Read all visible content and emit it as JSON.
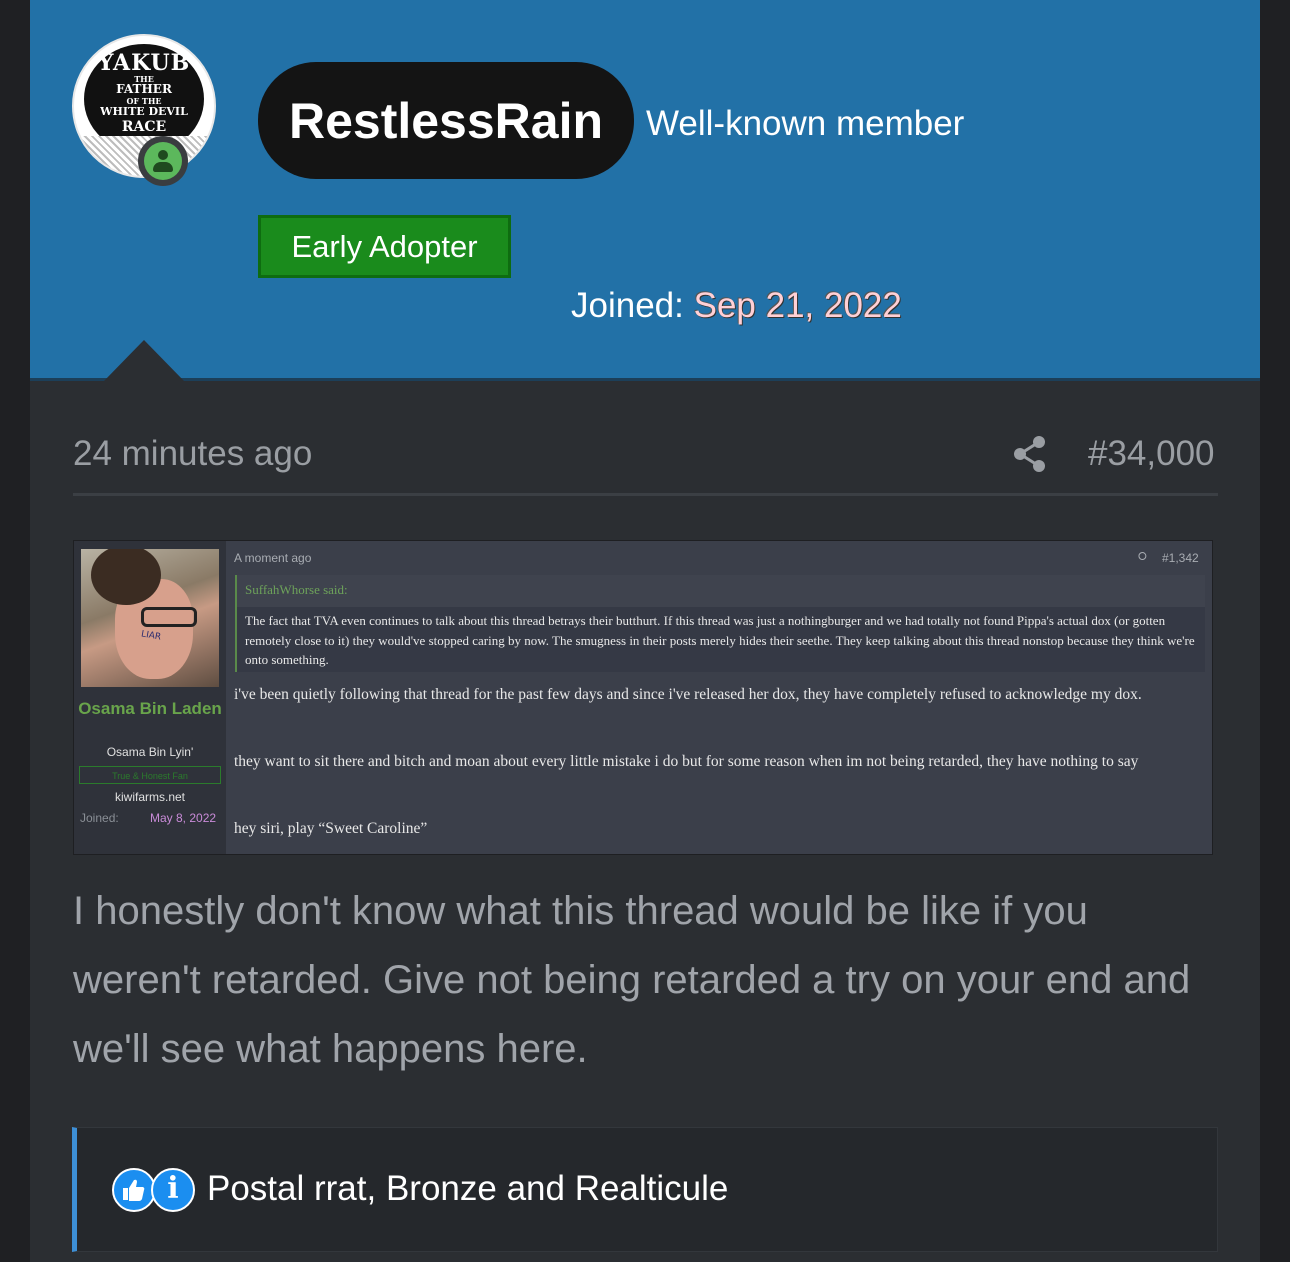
{
  "profile": {
    "avatar_text": [
      "YAKUB",
      "THE",
      "FATHER",
      "OF THE",
      "WHITE DEVIL",
      "RACE"
    ],
    "username": "RestlessRain",
    "user_title": "Well-known member",
    "banner": "Early Adopter",
    "joined_label": "Joined:",
    "joined_date": "Sep 21, 2022"
  },
  "post": {
    "time": "24 minutes ago",
    "post_number": "#34,000",
    "body": "I honestly don't know what this thread would be like if you weren't retarded. Give not being retarded a try on your end and we'll see what happens here."
  },
  "embedded": {
    "photo_label": "LIAR",
    "name": "Osama Bin Laden",
    "user_title": "Osama Bin Lyin'",
    "banner": "True & Honest Fan",
    "site": "kiwifarms.net",
    "joined_label": "Joined:",
    "joined_date": "May 8, 2022",
    "time": "A moment ago",
    "post_number": "#1,342",
    "quote_author": "SuffahWhorse said:",
    "quote_text": "The fact that TVA even continues to talk about this thread betrays their butthurt. If this thread was just a nothingburger and we had totally not found Pippa's actual dox (or gotten remotely close to it) they would've stopped caring by now. The smugness in their posts merely hides their seethe. They keep talking about this thread nonstop because they think we're onto something.",
    "paragraphs": [
      "i've been quietly following that thread for the past few days and since i've released her dox, they have completely refused to acknowledge my dox.",
      "they want to sit there and bitch and moan about every little mistake i do but for some reason when im not being retarded, they have nothing to say",
      "hey siri, play “Sweet Caroline”"
    ]
  },
  "reactions": {
    "icons": [
      "like-icon",
      "info-icon"
    ],
    "text": "Postal rrat, Bronze and Realticule"
  },
  "colors": {
    "header_bg": "#2271a7",
    "card_bg": "#2b2e32",
    "banner_green": "#1a8b1c",
    "online_green": "#5cb85c",
    "reaction_accent": "#3d8fd6"
  }
}
